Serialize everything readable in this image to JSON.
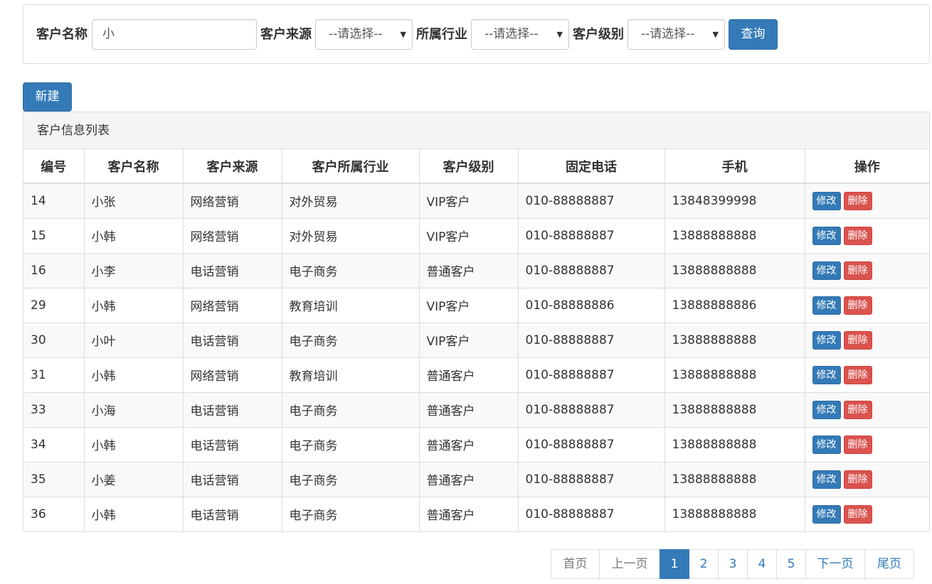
{
  "search": {
    "name_label": "客户名称",
    "name_value": "小",
    "source_label": "客户来源",
    "source_selected": "--请选择--",
    "industry_label": "所属行业",
    "industry_selected": "--请选择--",
    "level_label": "客户级别",
    "level_selected": "--请选择--",
    "query_button": "查询"
  },
  "toolbar": {
    "new_button": "新建"
  },
  "list": {
    "title": "客户信息列表",
    "columns": [
      "编号",
      "客户名称",
      "客户来源",
      "客户所属行业",
      "客户级别",
      "固定电话",
      "手机",
      "操作"
    ],
    "edit_label": "修改",
    "delete_label": "删除",
    "rows": [
      [
        "14",
        "小张",
        "网络营销",
        "对外贸易",
        "VIP客户",
        "010-88888887",
        "13848399998"
      ],
      [
        "15",
        "小韩",
        "网络营销",
        "对外贸易",
        "VIP客户",
        "010-88888887",
        "13888888888"
      ],
      [
        "16",
        "小李",
        "电话营销",
        "电子商务",
        "普通客户",
        "010-88888887",
        "13888888888"
      ],
      [
        "29",
        "小韩",
        "网络营销",
        "教育培训",
        "VIP客户",
        "010-88888886",
        "13888888886"
      ],
      [
        "30",
        "小叶",
        "电话营销",
        "电子商务",
        "VIP客户",
        "010-88888887",
        "13888888888"
      ],
      [
        "31",
        "小韩",
        "网络营销",
        "教育培训",
        "普通客户",
        "010-88888887",
        "13888888888"
      ],
      [
        "33",
        "小海",
        "电话营销",
        "电子商务",
        "普通客户",
        "010-88888887",
        "13888888888"
      ],
      [
        "34",
        "小韩",
        "电话营销",
        "电子商务",
        "普通客户",
        "010-88888887",
        "13888888888"
      ],
      [
        "35",
        "小姜",
        "电话营销",
        "电子商务",
        "普通客户",
        "010-88888887",
        "13888888888"
      ],
      [
        "36",
        "小韩",
        "电话营销",
        "电子商务",
        "普通客户",
        "010-88888887",
        "13888888888"
      ]
    ]
  },
  "pagination": {
    "first": "首页",
    "prev": "上一页",
    "pages": [
      "1",
      "2",
      "3",
      "4",
      "5"
    ],
    "current": "1",
    "next": "下一页",
    "last": "尾页"
  },
  "colors": {
    "primary": "#337ab7",
    "danger": "#d9534f",
    "border": "#dddddd",
    "heading_bg": "#f5f5f5",
    "stripe": "#f9f9f9"
  }
}
